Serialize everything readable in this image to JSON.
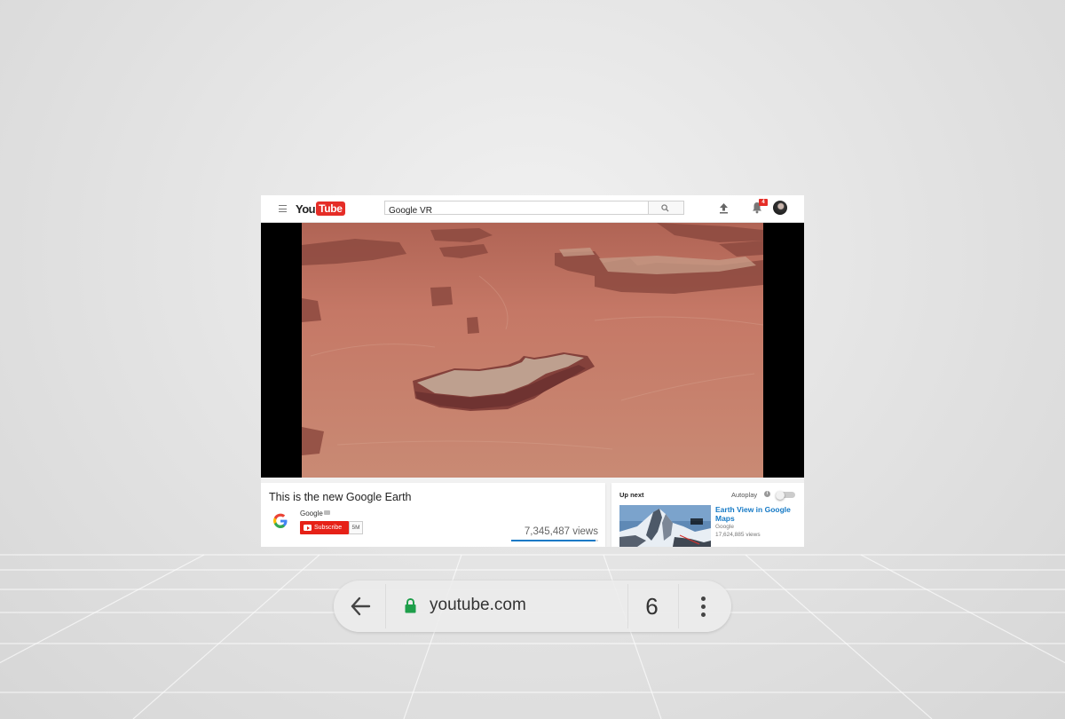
{
  "youtube": {
    "logo_you": "You",
    "logo_tube": "Tube",
    "search_value": "Google VR",
    "notification_count": "4"
  },
  "video": {
    "title": "This is the new Google Earth",
    "channel": "Google",
    "subscribe_label": "Subscribe",
    "subscriber_count": "5M",
    "views": "7,345,487 views"
  },
  "up_next": {
    "label": "Up next",
    "autoplay_label": "Autoplay",
    "autoplay_on": false,
    "items": [
      {
        "title": "Earth View in Google Maps",
        "channel": "Google",
        "views": "17,624,885 views"
      }
    ]
  },
  "browser": {
    "url": "youtube.com",
    "tab_count": "6",
    "secure": true
  },
  "colors": {
    "youtube_red": "#e52d27",
    "subscribe_red": "#e62117",
    "link_blue": "#167ac6",
    "lock_green": "#1e9e4a"
  }
}
